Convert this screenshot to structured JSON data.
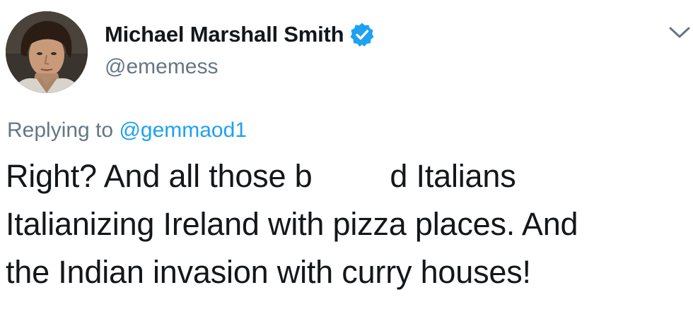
{
  "author": {
    "display_name": "Michael Marshall Smith",
    "handle": "@ememess",
    "verified": true,
    "avatar_icon": "profile-photo"
  },
  "reply": {
    "prefix": "Replying to",
    "mention": "@gemmaod1"
  },
  "tweet": {
    "line1_start": "Right? And all those b",
    "line1_end": "d Italians",
    "line2": "Italianizing Ireland with pizza places. And",
    "line3": "the Indian invasion with curry houses!"
  },
  "colors": {
    "text": "#14171a",
    "secondary": "#657786",
    "accent": "#1da1f2"
  },
  "icons": {
    "verified": "verified-badge-icon",
    "menu": "chevron-down-icon"
  }
}
